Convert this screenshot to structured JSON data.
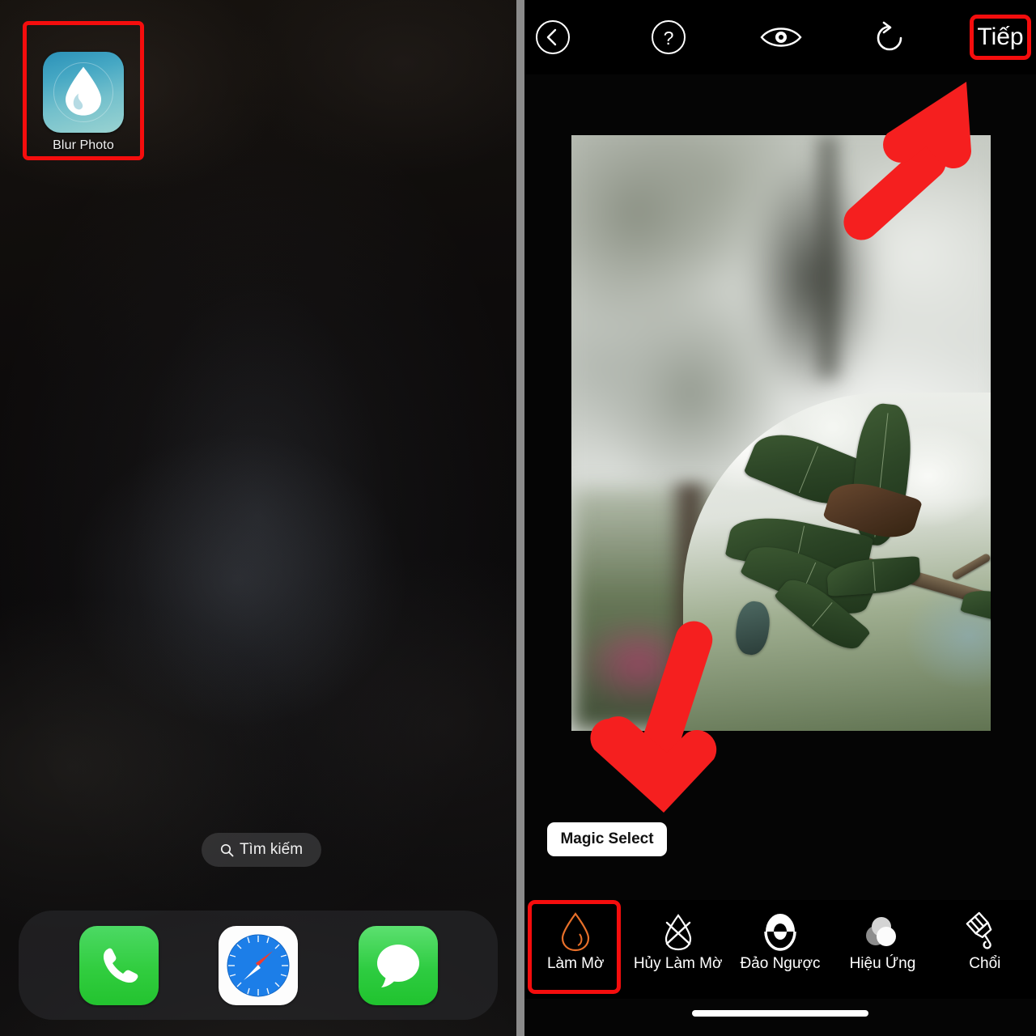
{
  "colors": {
    "highlight_red": "#f50d0d",
    "arrow_red": "#f51f1f",
    "accent_orange": "#e8702a",
    "panel_black": "#000000",
    "divider_gray": "#8b8b8b"
  },
  "left_panel": {
    "name": "ios-home-screen",
    "app": {
      "label": "Blur Photo",
      "icon": "water-droplet-icon",
      "highlighted": true
    },
    "search": {
      "label": "Tìm kiếm",
      "icon": "search-icon"
    },
    "dock": [
      {
        "label": "Phone",
        "icon": "phone-icon"
      },
      {
        "label": "Safari",
        "icon": "safari-compass-icon"
      },
      {
        "label": "Messages",
        "icon": "messages-bubble-icon"
      }
    ]
  },
  "right_panel": {
    "name": "blur-photo-editor",
    "topbar": {
      "back": {
        "label": "",
        "icon": "chevron-left-circle-icon"
      },
      "help": {
        "label": "",
        "icon": "question-mark-circle-icon"
      },
      "preview": {
        "label": "",
        "icon": "eye-icon"
      },
      "undo": {
        "label": "",
        "icon": "undo-rotate-icon"
      },
      "next": {
        "label": "Tiếp",
        "highlighted": true
      }
    },
    "tooltip": {
      "label": "Magic Select"
    },
    "photo": {
      "description": "Blurred photo of plumeria leaves on a branch with sharp selected region"
    },
    "toolbar": [
      {
        "label": "Làm Mờ",
        "icon": "droplet-outline-icon",
        "active": true
      },
      {
        "label": "Hủy Làm Mờ",
        "icon": "droplet-crossed-icon",
        "active": false
      },
      {
        "label": "Đảo Ngược",
        "icon": "invert-circle-icon",
        "active": false
      },
      {
        "label": "Hiệu Ứng",
        "icon": "overlapping-circles-icon",
        "active": false
      },
      {
        "label": "Chổi",
        "icon": "paintbrush-icon",
        "active": false
      }
    ],
    "home_indicator": {
      "label": "",
      "icon": "home-indicator-bar"
    }
  },
  "annotations": {
    "arrow_to_next": "red-arrow-up-right",
    "arrow_to_blur": "red-arrow-down-left"
  }
}
